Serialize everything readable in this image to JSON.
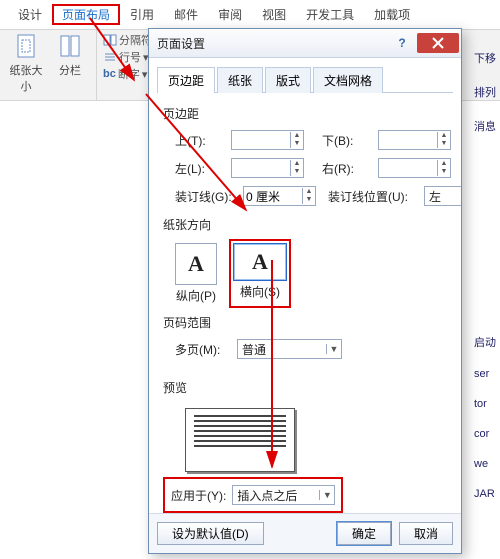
{
  "ribbon": {
    "tabs": [
      "设计",
      "页面布局",
      "引用",
      "邮件",
      "审阅",
      "视图",
      "开发工具",
      "加载项"
    ],
    "active_tab_index": 1,
    "group1": {
      "size_label": "纸张大小",
      "columns_label": "分栏"
    },
    "group2": {
      "breaks": "分隔符",
      "linenum": "行号",
      "hyphen": "断字"
    },
    "right_hint": "下移"
  },
  "right_strip": [
    "排列",
    "消息",
    "启动",
    "ser",
    "tor",
    "cor",
    "we",
    "JAR"
  ],
  "dialog": {
    "title": "页面设置",
    "tabs": [
      "页边距",
      "纸张",
      "版式",
      "文档网格"
    ],
    "active_tab_index": 0,
    "margins_header": "页边距",
    "top_label": "上(T):",
    "bottom_label": "下(B):",
    "left_label": "左(L):",
    "right_label": "右(R):",
    "gutter_label": "装订线(G):",
    "gutter_value": "0 厘米",
    "gutter_pos_label": "装订线位置(U):",
    "gutter_pos_value": "左",
    "orientation_header": "纸张方向",
    "portrait_label": "纵向(P)",
    "landscape_label": "横向(S)",
    "pages_header": "页码范围",
    "multi_label": "多页(M):",
    "multi_value": "普通",
    "preview_header": "预览",
    "apply_label": "应用于(Y):",
    "apply_value": "插入点之后",
    "default_btn": "设为默认值(D)",
    "ok_btn": "确定",
    "cancel_btn": "取消"
  }
}
